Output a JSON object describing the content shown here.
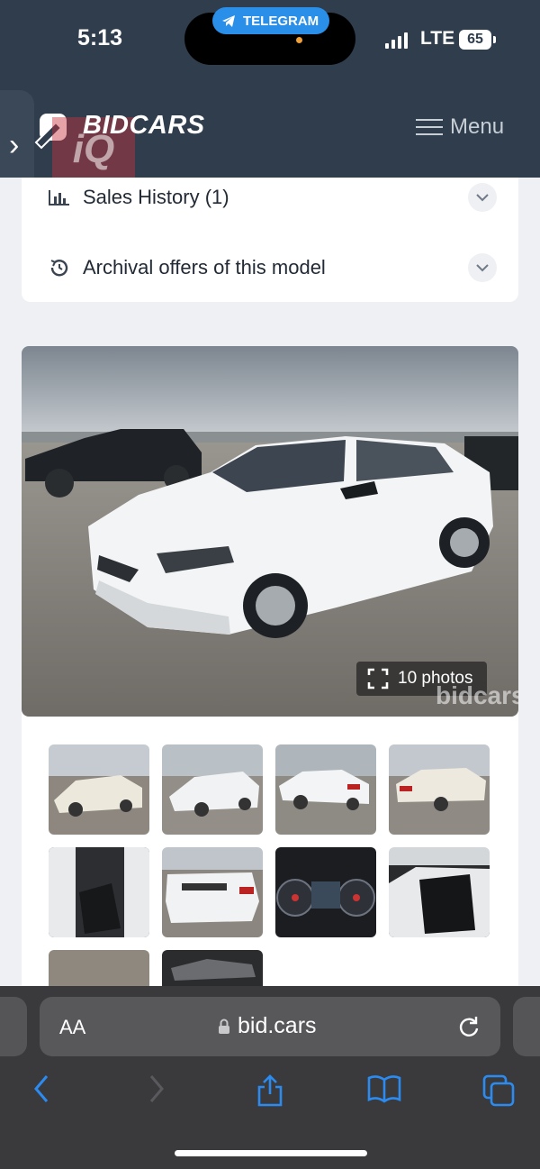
{
  "status_bar": {
    "time": "5:13",
    "telegram_label": "TELEGRAM",
    "network": "LTE",
    "battery": "65"
  },
  "header": {
    "logo_text": "BIDCARS",
    "watermark": "iQ",
    "menu_label": "Menu"
  },
  "sections": {
    "sales_history_label": "Sales History (1)",
    "archival_label": "Archival offers of this model"
  },
  "gallery": {
    "photo_count_label": "10 photos",
    "watermark_text": "bidcars",
    "thumbnail_count": 10
  },
  "browser": {
    "text_size_label": "AA",
    "url": "bid.cars"
  },
  "colors": {
    "header_bg": "#2f3d4d",
    "accent_blue": "#2b8bf0",
    "telegram_blue": "#2a8fe8"
  }
}
